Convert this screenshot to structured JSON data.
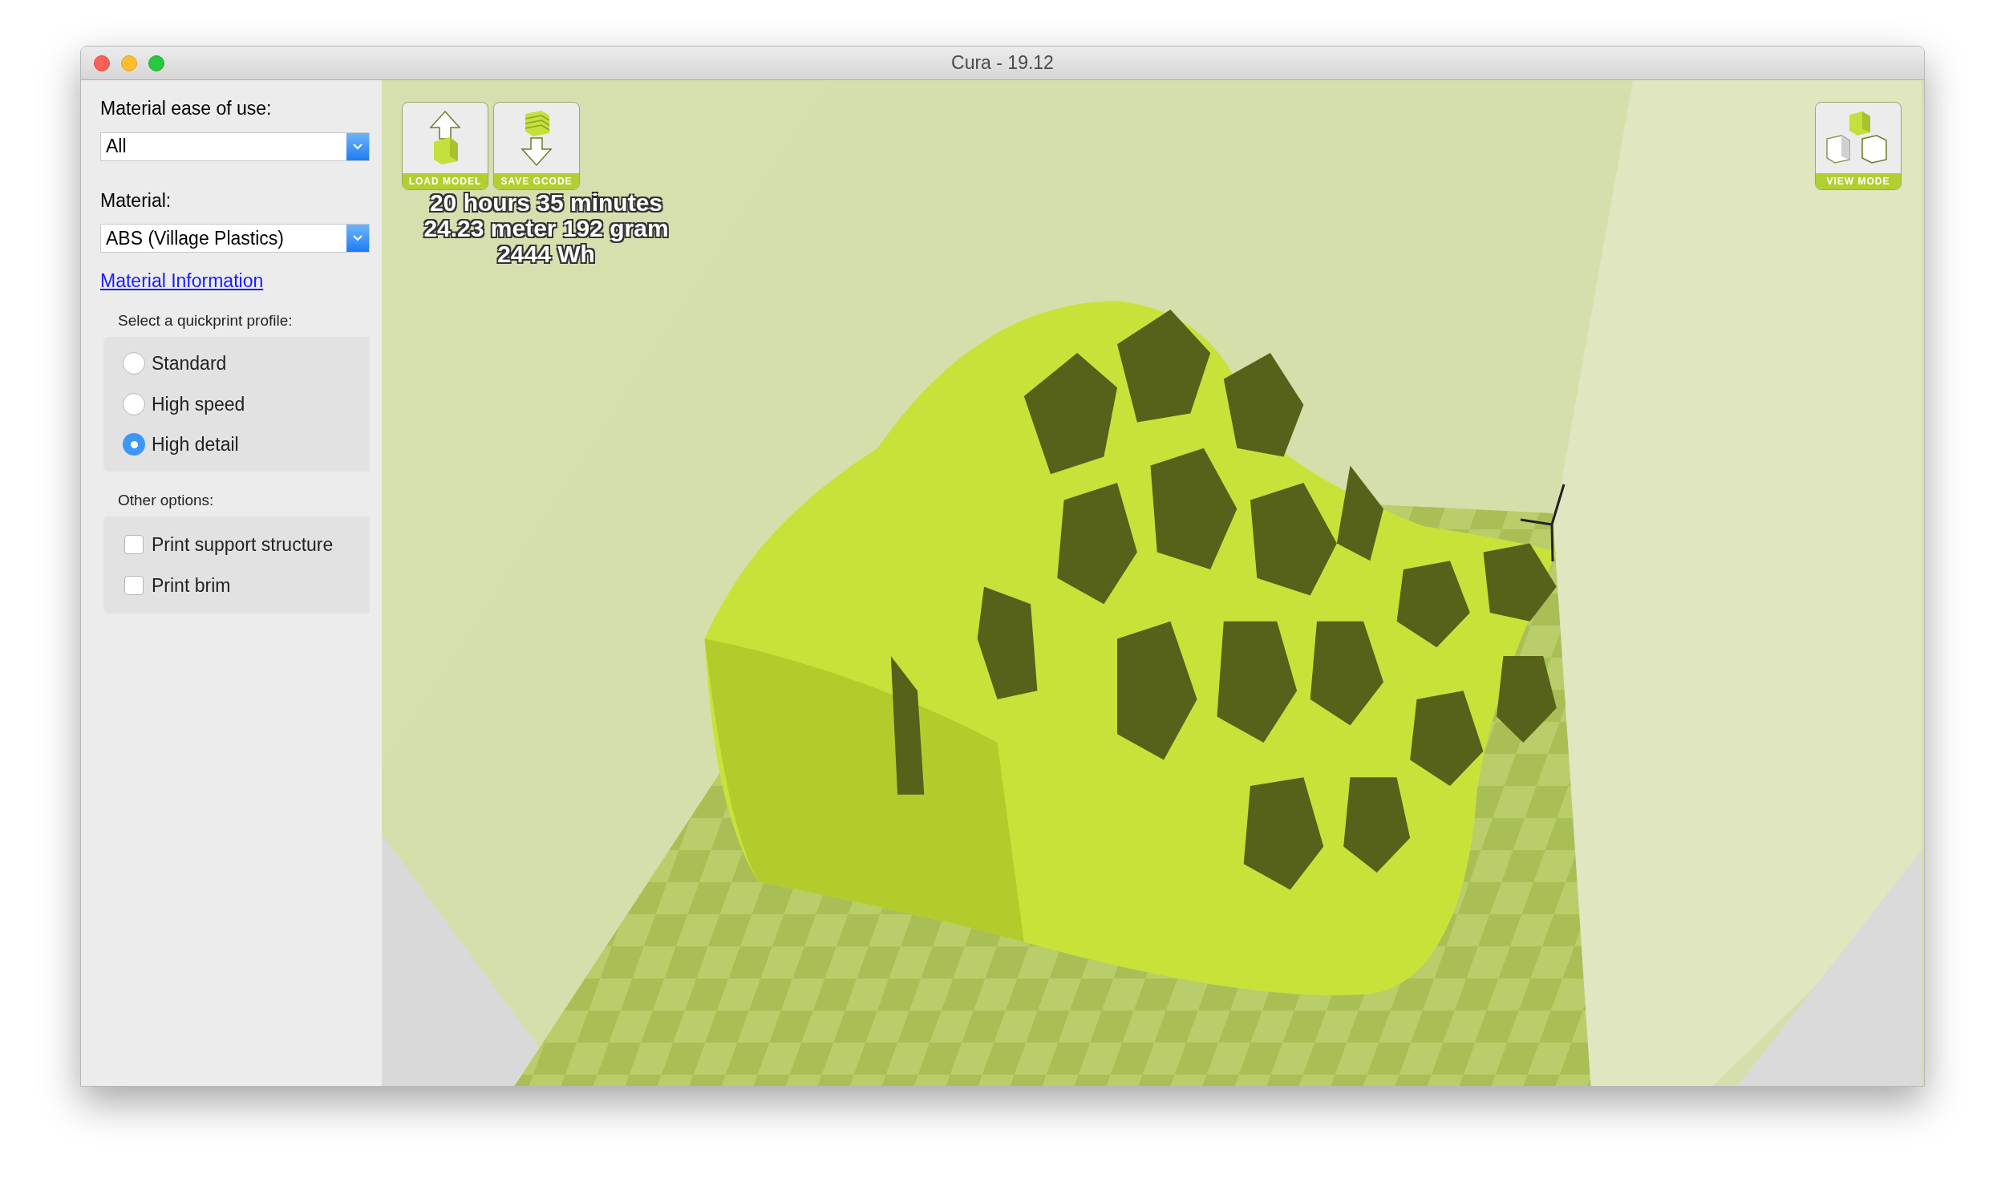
{
  "window": {
    "title": "Cura - 19.12"
  },
  "sidebar": {
    "ease_label": "Material ease of use:",
    "ease_value": "All",
    "material_label": "Material:",
    "material_value": "ABS (Village Plastics)",
    "material_link": "Material Information",
    "profile_group": {
      "title": "Select a quickprint profile:",
      "options": [
        {
          "label": "Standard",
          "selected": false
        },
        {
          "label": "High speed",
          "selected": false
        },
        {
          "label": "High detail",
          "selected": true
        }
      ]
    },
    "other_group": {
      "title": "Other options:",
      "options": [
        {
          "label": "Print support structure",
          "checked": false
        },
        {
          "label": "Print brim",
          "checked": false
        }
      ]
    }
  },
  "toolbar": {
    "buttons": [
      {
        "kind": "load",
        "label": "LOAD MODEL"
      },
      {
        "kind": "save",
        "label": "SAVE GCODE"
      }
    ]
  },
  "print_stats": [
    "20 hours 35 minutes",
    "24.23 meter 192 gram",
    "2444 Wh"
  ],
  "view_mode": {
    "label": "VIEW MODE"
  }
}
